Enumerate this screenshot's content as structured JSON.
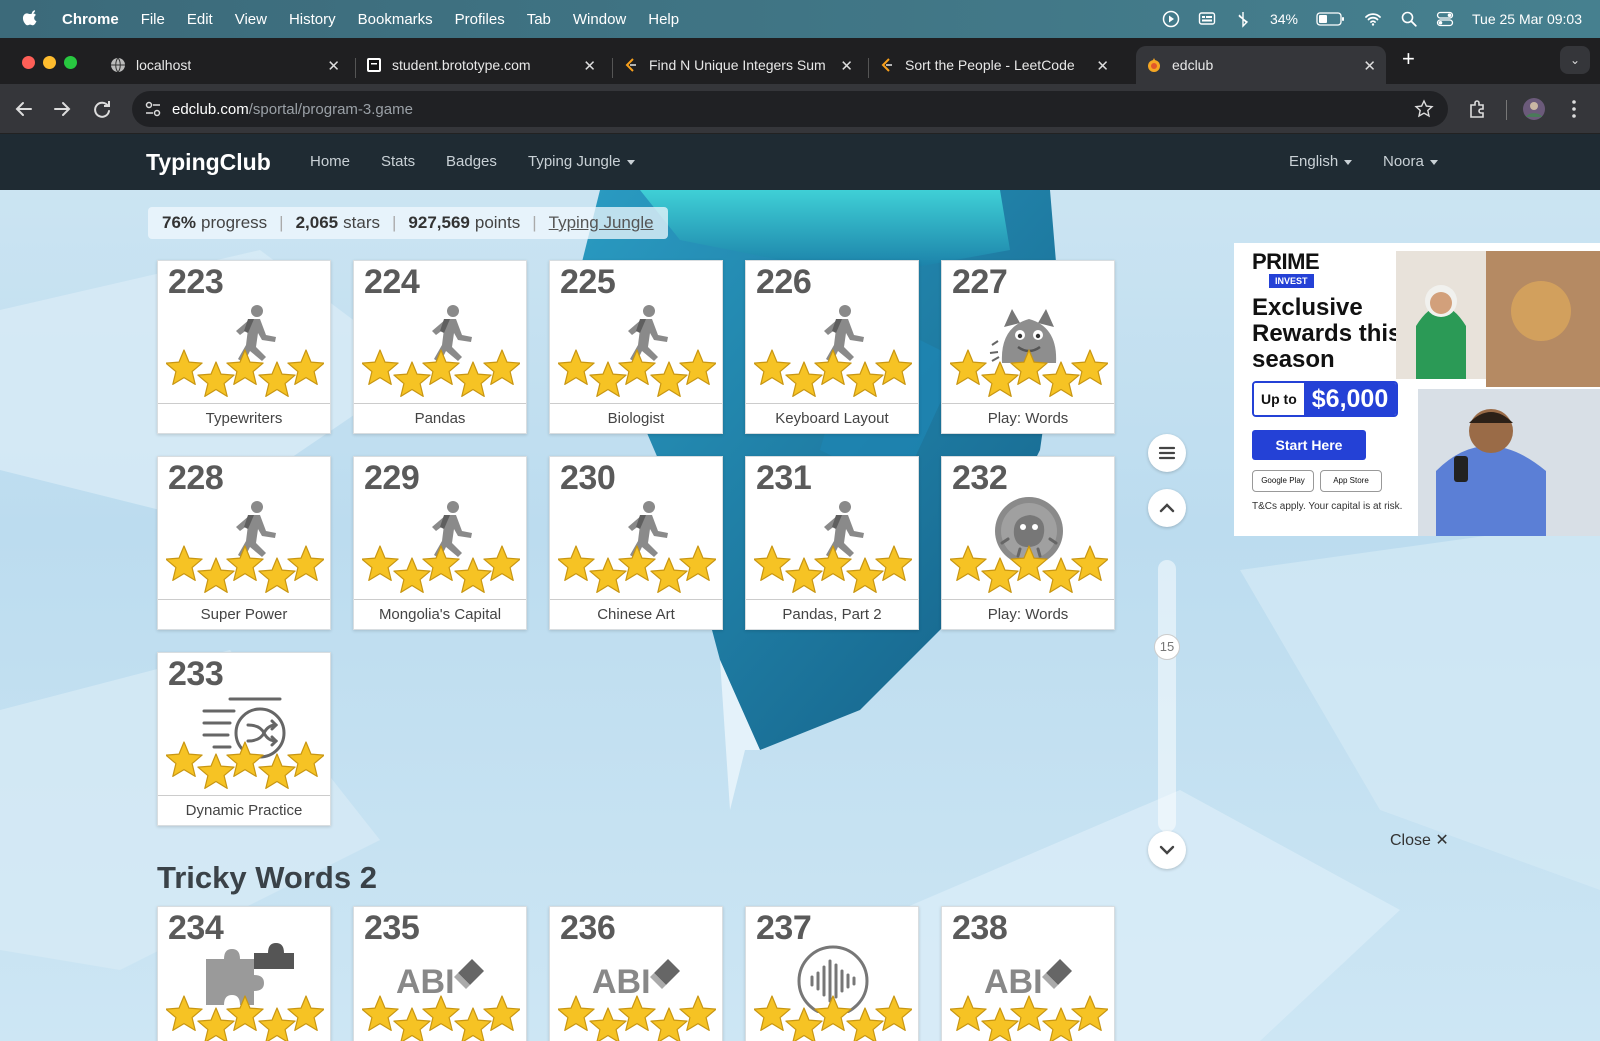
{
  "menubar": {
    "app": "Chrome",
    "items": [
      "File",
      "Edit",
      "View",
      "History",
      "Bookmarks",
      "Profiles",
      "Tab",
      "Window",
      "Help"
    ],
    "battery": "34%",
    "datetime": "Tue 25 Mar  09:03"
  },
  "tabs": [
    {
      "title": "localhost"
    },
    {
      "title": "student.brototype.com"
    },
    {
      "title": "Find N Unique Integers Sum u"
    },
    {
      "title": "Sort the People - LeetCode"
    },
    {
      "title": "edclub"
    }
  ],
  "newtab": "+",
  "address": {
    "domain": "edclub.com",
    "path": "/sportal/program-3.game"
  },
  "site": {
    "brand": "TypingClub",
    "nav": [
      "Home",
      "Stats",
      "Badges",
      "Typing Jungle"
    ],
    "language": "English",
    "user": "Noora"
  },
  "progress": {
    "percent": "76%",
    "percent_label": "progress",
    "stars": "2,065",
    "stars_label": "stars",
    "points": "927,569",
    "points_label": "points",
    "link": "Typing Jungle",
    "sep": "|"
  },
  "lessons": [
    {
      "num": "223",
      "label": "Typewriters",
      "icon": "runner-icon"
    },
    {
      "num": "224",
      "label": "Pandas",
      "icon": "runner-icon"
    },
    {
      "num": "225",
      "label": "Biologist",
      "icon": "runner-icon"
    },
    {
      "num": "226",
      "label": "Keyboard Layout",
      "icon": "runner-icon"
    },
    {
      "num": "227",
      "label": "Play: Words",
      "icon": "monster-icon"
    },
    {
      "num": "228",
      "label": "Super Power",
      "icon": "runner-icon"
    },
    {
      "num": "229",
      "label": "Mongolia's Capital",
      "icon": "runner-icon"
    },
    {
      "num": "230",
      "label": "Chinese Art",
      "icon": "runner-icon"
    },
    {
      "num": "231",
      "label": "Pandas, Part 2",
      "icon": "runner-icon"
    },
    {
      "num": "232",
      "label": "Play: Words",
      "icon": "game-bubble-icon"
    },
    {
      "num": "233",
      "label": "Dynamic Practice",
      "icon": "shuffle-list-icon"
    }
  ],
  "section2": {
    "title": "Tricky Words 2",
    "lessons": [
      {
        "num": "234",
        "icon": "puzzle-icon"
      },
      {
        "num": "235",
        "icon": "abc-eraser-icon"
      },
      {
        "num": "236",
        "icon": "abc-eraser-icon"
      },
      {
        "num": "237",
        "icon": "soundwave-icon"
      },
      {
        "num": "238",
        "icon": "abc-eraser-icon"
      }
    ]
  },
  "scroll": {
    "page_marker": "15"
  },
  "ad": {
    "logo": "PRIME",
    "tag": "INVEST",
    "headline": "Exclusive Rewards this season",
    "upto": "Up to",
    "amount": "$6,000",
    "cta": "Start Here",
    "store1": "Google Play",
    "store2": "App Store",
    "disclaimer": "T&Cs apply. Your capital is at risk.",
    "close": "Close"
  },
  "colors": {
    "star_gold": "#f6c324",
    "ad_blue": "#2441d6",
    "nav_bg": "#1f2b33"
  }
}
